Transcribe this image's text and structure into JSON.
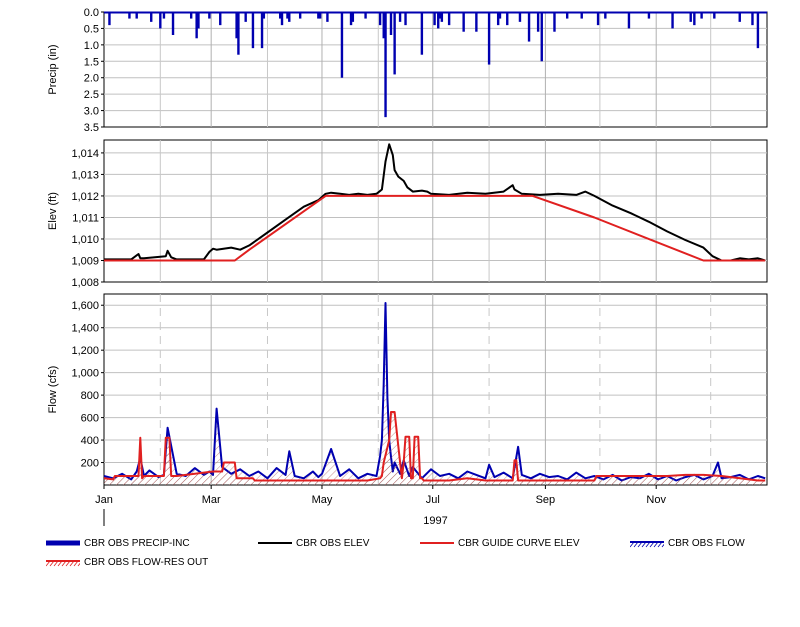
{
  "chart_data": [
    {
      "type": "bar",
      "ylabel": "Precip (in)",
      "ylim": [
        3.5,
        0.0
      ],
      "yticks": [
        "0.0",
        "0.5",
        "1.0",
        "1.5",
        "2.0",
        "2.5",
        "3.0",
        "3.5"
      ],
      "ytick_values": [
        0,
        0.5,
        1,
        1.5,
        2,
        2.5,
        3,
        3.5
      ],
      "grid": true,
      "series": [
        {
          "name": "CBR OBS PRECIP-INC",
          "color": "#0000b0",
          "x": [
            3,
            14,
            18,
            26,
            31,
            33,
            38,
            48,
            51,
            52,
            58,
            64,
            73,
            74,
            78,
            82,
            87,
            88,
            97,
            98,
            101,
            102,
            108,
            118,
            119,
            123,
            131,
            136,
            137,
            144,
            152,
            154,
            155,
            158,
            160,
            163,
            166,
            175,
            182,
            184,
            185,
            186,
            190,
            198,
            205,
            212,
            217,
            218,
            222,
            229,
            234,
            239,
            241,
            248,
            255,
            263,
            272,
            276,
            289,
            300,
            313,
            323,
            325,
            329,
            336,
            350,
            357,
            360
          ],
          "values": [
            0.4,
            0.2,
            0.2,
            0.3,
            0.5,
            0.2,
            0.7,
            0.2,
            0.8,
            0.5,
            0.2,
            0.4,
            0.8,
            1.3,
            0.3,
            1.1,
            1.1,
            0.2,
            0.2,
            0.4,
            0.2,
            0.3,
            0.2,
            0.2,
            0.2,
            0.3,
            2.0,
            0.4,
            0.3,
            0.2,
            0.4,
            0.8,
            3.2,
            0.7,
            1.9,
            0.3,
            0.4,
            1.3,
            0.4,
            0.5,
            0.2,
            0.3,
            0.4,
            0.6,
            0.6,
            1.6,
            0.4,
            0.2,
            0.4,
            0.3,
            0.9,
            0.6,
            1.5,
            0.6,
            0.2,
            0.2,
            0.4,
            0.2,
            0.5,
            0.2,
            0.5,
            0.3,
            0.4,
            0.2,
            0.2,
            0.3,
            0.4,
            1.1
          ]
        }
      ]
    },
    {
      "type": "line",
      "ylabel": "Elev (ft)",
      "ylim": [
        1008,
        1014.6
      ],
      "yticks": [
        "1,008",
        "1,009",
        "1,010",
        "1,011",
        "1,012",
        "1,013",
        "1,014"
      ],
      "ytick_values": [
        1008,
        1009,
        1010,
        1011,
        1012,
        1013,
        1014
      ],
      "grid": true,
      "series": [
        {
          "name": "CBR OBS ELEV",
          "color": "#000000",
          "x": [
            0,
            15,
            19,
            20,
            22,
            34,
            35,
            37,
            40,
            55,
            58,
            60,
            62,
            70,
            75,
            80,
            90,
            100,
            110,
            118,
            122,
            125,
            130,
            135,
            140,
            145,
            150,
            153,
            155,
            157,
            159,
            160,
            162,
            165,
            167,
            170,
            175,
            178,
            180,
            190,
            200,
            210,
            220,
            225,
            226,
            230,
            240,
            250,
            260,
            265,
            270,
            280,
            290,
            300,
            310,
            320,
            330,
            335,
            340,
            345,
            350,
            355,
            360,
            364
          ],
          "values": [
            1009.05,
            1009.05,
            1009.3,
            1009.1,
            1009.1,
            1009.2,
            1009.45,
            1009.15,
            1009.05,
            1009.05,
            1009.4,
            1009.55,
            1009.5,
            1009.6,
            1009.5,
            1009.7,
            1010.3,
            1010.9,
            1011.5,
            1011.8,
            1012.1,
            1012.15,
            1012.1,
            1012.05,
            1012.1,
            1012.05,
            1012.1,
            1012.3,
            1013.6,
            1014.4,
            1013.9,
            1013.2,
            1012.9,
            1012.7,
            1012.4,
            1012.2,
            1012.25,
            1012.2,
            1012.1,
            1012.05,
            1012.15,
            1012.1,
            1012.2,
            1012.5,
            1012.3,
            1012.1,
            1012.05,
            1012.1,
            1012.05,
            1012.2,
            1012.0,
            1011.55,
            1011.2,
            1010.8,
            1010.35,
            1009.95,
            1009.6,
            1009.2,
            1009.0,
            1009.0,
            1009.1,
            1009.05,
            1009.1,
            1009.0
          ]
        },
        {
          "name": "CBR GUIDE CURVE ELEV",
          "color": "#e02020",
          "x": [
            0,
            15,
            20,
            72,
            80,
            122,
            236,
            270,
            330,
            340,
            364
          ],
          "values": [
            1009.0,
            1009.0,
            1009.0,
            1009.0,
            1009.5,
            1012.0,
            1012.0,
            1011.0,
            1009.0,
            1009.0,
            1009.0
          ]
        }
      ]
    },
    {
      "type": "line",
      "ylabel": "Flow (cfs)",
      "xlabel": "1997",
      "ylim": [
        0,
        1700
      ],
      "yticks": [
        "200",
        "400",
        "600",
        "800",
        "1,000",
        "1,200",
        "1,400",
        "1,600"
      ],
      "ytick_values": [
        200,
        400,
        600,
        800,
        1000,
        1200,
        1400,
        1600
      ],
      "xticks": [
        "Jan",
        "Mar",
        "May",
        "Jul",
        "Sep",
        "Nov"
      ],
      "xtick_days": [
        0,
        59,
        120,
        181,
        243,
        304
      ],
      "month_days": [
        0,
        31,
        59,
        90,
        120,
        151,
        181,
        212,
        243,
        273,
        304,
        334,
        365
      ],
      "grid": true,
      "series": [
        {
          "name": "CBR OBS FLOW",
          "color": "#0000b0",
          "x": [
            0,
            5,
            10,
            15,
            18,
            20,
            22,
            25,
            30,
            33,
            35,
            40,
            45,
            50,
            55,
            58,
            60,
            62,
            65,
            70,
            75,
            80,
            85,
            90,
            95,
            100,
            102,
            105,
            110,
            115,
            118,
            120,
            125,
            130,
            135,
            140,
            145,
            150,
            152,
            153,
            154,
            155,
            156,
            157,
            158,
            159,
            160,
            163,
            165,
            168,
            170,
            175,
            180,
            185,
            190,
            195,
            200,
            205,
            210,
            212,
            215,
            220,
            225,
            228,
            230,
            235,
            240,
            245,
            250,
            255,
            260,
            265,
            270,
            275,
            280,
            285,
            290,
            295,
            300,
            305,
            310,
            315,
            320,
            325,
            330,
            335,
            338,
            340,
            345,
            350,
            355,
            360,
            364
          ],
          "values": [
            80,
            60,
            100,
            50,
            120,
            240,
            80,
            130,
            70,
            90,
            510,
            100,
            80,
            150,
            90,
            120,
            90,
            680,
            160,
            100,
            140,
            80,
            120,
            60,
            150,
            90,
            300,
            80,
            60,
            120,
            70,
            100,
            320,
            80,
            140,
            60,
            100,
            80,
            260,
            400,
            900,
            1620,
            780,
            400,
            250,
            120,
            200,
            100,
            220,
            80,
            160,
            60,
            140,
            80,
            100,
            60,
            120,
            90,
            60,
            180,
            70,
            110,
            60,
            340,
            90,
            60,
            100,
            70,
            80,
            50,
            110,
            60,
            80,
            50,
            90,
            40,
            70,
            60,
            100,
            50,
            80,
            40,
            70,
            90,
            50,
            80,
            200,
            60,
            70,
            90,
            50,
            80,
            60
          ]
        },
        {
          "name": "CBR OBS FLOW-RES OUT",
          "color": "#e02020",
          "x": [
            0,
            5,
            6,
            19,
            20,
            21,
            22,
            33,
            34,
            36,
            37,
            40,
            60,
            65,
            66,
            72,
            73,
            82,
            83,
            118,
            119,
            145,
            152,
            153,
            154,
            157,
            158,
            160,
            163,
            164,
            165,
            166,
            168,
            169,
            170,
            171,
            173,
            174,
            175,
            176,
            190,
            200,
            210,
            225,
            226,
            227,
            228,
            230,
            260,
            270,
            271,
            290,
            291,
            310,
            320,
            330,
            340,
            350,
            360,
            364
          ],
          "values": [
            60,
            50,
            80,
            80,
            420,
            60,
            80,
            80,
            420,
            420,
            80,
            80,
            120,
            120,
            200,
            200,
            60,
            60,
            40,
            40,
            40,
            40,
            60,
            80,
            200,
            400,
            650,
            650,
            200,
            60,
            200,
            430,
            430,
            60,
            60,
            430,
            430,
            60,
            60,
            40,
            40,
            60,
            40,
            40,
            220,
            220,
            40,
            40,
            40,
            40,
            80,
            80,
            80,
            80,
            90,
            90,
            80,
            60,
            40,
            40
          ]
        }
      ]
    }
  ],
  "legend": [
    {
      "label": "CBR OBS PRECIP-INC",
      "color": "#0000b0",
      "style": "thick"
    },
    {
      "label": "CBR OBS ELEV",
      "color": "#000000",
      "style": "line"
    },
    {
      "label": "CBR GUIDE CURVE ELEV",
      "color": "#e02020",
      "style": "line"
    },
    {
      "label": "CBR OBS FLOW",
      "color": "#0000b0",
      "style": "hatch"
    },
    {
      "label": "CBR OBS FLOW-RES OUT",
      "color": "#e02020",
      "style": "hatch"
    }
  ]
}
